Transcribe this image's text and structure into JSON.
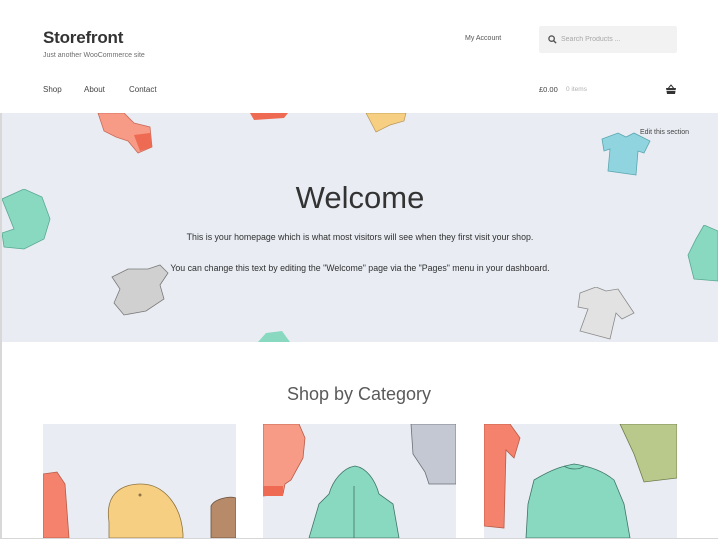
{
  "site": {
    "title": "Storefront",
    "tagline": "Just another WooCommerce site"
  },
  "header": {
    "my_account": "My Account",
    "search_placeholder": "Search Products ...",
    "search_icon": "search-icon",
    "cart": {
      "total": "£0.00",
      "count": "0 items",
      "icon": "basket-icon"
    }
  },
  "nav": {
    "items": [
      {
        "label": "Shop"
      },
      {
        "label": "About"
      },
      {
        "label": "Contact"
      }
    ]
  },
  "hero": {
    "edit_link": "Edit this section",
    "title": "Welcome",
    "lines": [
      "This is your homepage which is what most visitors will see when they first visit your shop.",
      "You can change this text by editing the \"Welcome\" page via the \"Pages\" menu in your dashboard."
    ],
    "background_color": "#e9edf3"
  },
  "categories": {
    "title": "Shop by Category",
    "items": [
      {
        "image": "accessories-illustration"
      },
      {
        "image": "hoodies-illustration"
      },
      {
        "image": "tshirts-illustration"
      }
    ]
  },
  "colors": {
    "coral": "#f4826c",
    "mint": "#7fd6bd",
    "yellow": "#f6cf83",
    "grey": "#c9c9c9",
    "olive": "#b9c98c",
    "blue": "#8fd4de"
  }
}
